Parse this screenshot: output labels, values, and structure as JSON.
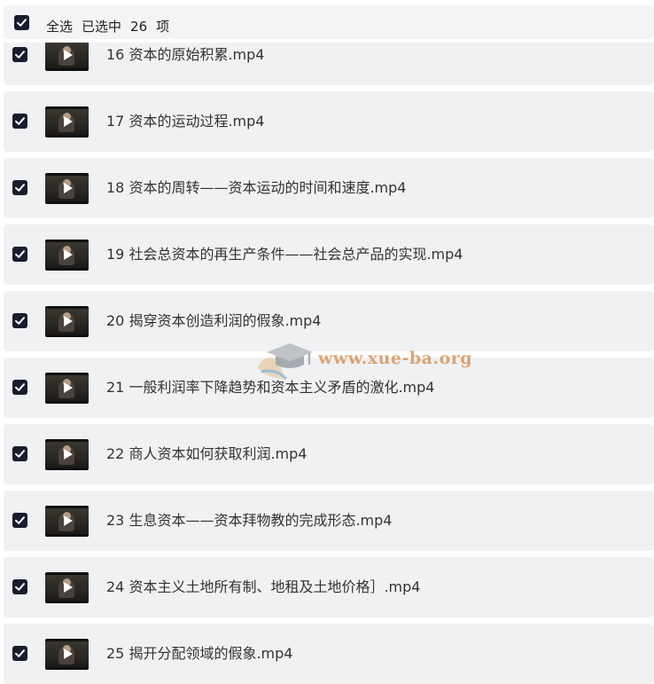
{
  "header": {
    "select_all_label": "全选",
    "selected_prefix": "已选中",
    "selected_count": "26",
    "selected_suffix": "项"
  },
  "items": [
    {
      "title": "16 资本的原始积累.mp4",
      "checked": true
    },
    {
      "title": "17 资本的运动过程.mp4",
      "checked": true
    },
    {
      "title": "18 资本的周转——资本运动的时间和速度.mp4",
      "checked": true
    },
    {
      "title": "19 社会总资本的再生产条件——社会总产品的实现.mp4",
      "checked": true
    },
    {
      "title": "20 揭穿资本创造利润的假象.mp4",
      "checked": true
    },
    {
      "title": "21 一般利润率下降趋势和资本主义矛盾的激化.mp4",
      "checked": true
    },
    {
      "title": "22 商人资本如何获取利润.mp4",
      "checked": true
    },
    {
      "title": "23 生息资本——资本拜物教的完成形态.mp4",
      "checked": true
    },
    {
      "title": "24 资本主义土地所有制、地租及土地价格］.mp4",
      "checked": true
    },
    {
      "title": "25 揭开分配领域的假象.mp4",
      "checked": true
    }
  ],
  "watermark": {
    "text": "www.xue-ba.org",
    "icon": "graduation-cap-icon"
  },
  "colors": {
    "checkbox": "#1a1c2e",
    "row_background": "#f0f1f3",
    "watermark_text": "#d4965f"
  }
}
